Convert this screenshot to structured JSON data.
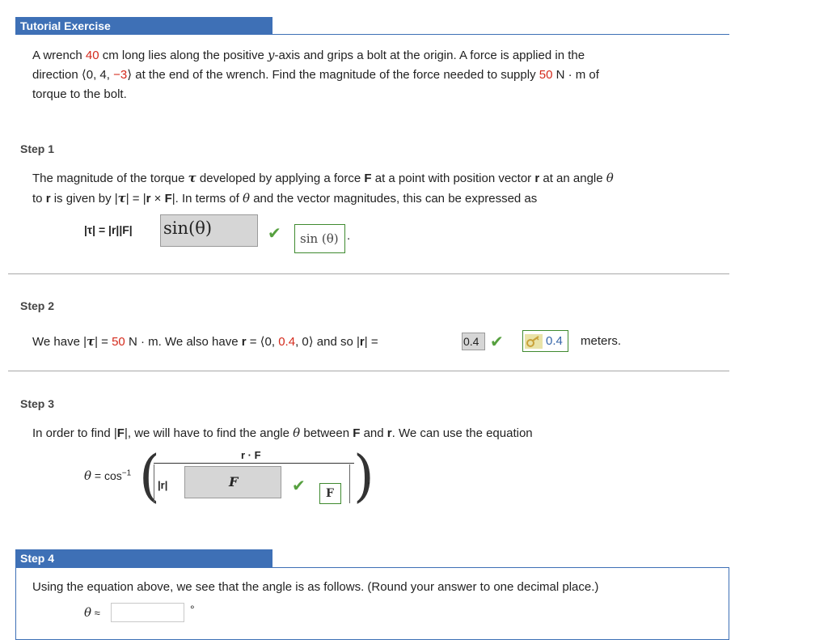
{
  "tutorial": {
    "title": "Tutorial Exercise",
    "problem": {
      "t1": "A wrench ",
      "length": "40",
      "t2": " cm long lies along the positive ",
      "yaxis": "y",
      "t3": "-axis and grips a bolt at the origin. A force is applied in the",
      "t4": "direction ",
      "open": "⟨",
      "d1": "0",
      "comma1": ", ",
      "d2": "4",
      "comma2": ", ",
      "d3": "−3",
      "close": "⟩",
      "t5": " at the end of the wrench. Find the magnitude of the force needed to supply ",
      "torque": "50",
      "t6": " N · m of",
      "t7": "torque to the bolt."
    }
  },
  "step1": {
    "label": "Step 1",
    "l1a": "The magnitude of the torque ",
    "tau": "τ",
    "l1b": " developed by applying a force ",
    "F": "F",
    "l1c": " at a point with position vector ",
    "r": "r",
    "l1d": " at an angle ",
    "theta": "θ",
    "l2a": "to ",
    "r2": "r",
    "l2b": " is given by  |",
    "tau2": "τ",
    "l2c": "|  =  |",
    "r3": "r",
    "l2d": " × ",
    "F2": "F",
    "l2e": "|.  In terms of ",
    "theta2": "θ",
    "l2f": " and the vector magnitudes, this can be expressed as",
    "eq_prefix": "|τ|  =  |r||F|",
    "answer_entered": "sin(θ)",
    "answer_key": "sin (θ)",
    "period": "."
  },
  "step2": {
    "label": "Step 2",
    "t1": "We have  |",
    "tau": "τ",
    "t2": "|  =  ",
    "torque": "50",
    "t3": " N · m.  We also have  ",
    "r": "r",
    "t4": " = ",
    "open": "⟨",
    "v1": "0",
    "c1": ", ",
    "v2": "0.4",
    "c2": ", ",
    "v3": "0",
    "close": "⟩",
    "t5": "  and so  |",
    "r2": "r",
    "t6": "|  = ",
    "answer_entered": "0.4",
    "answer_key": "0.4",
    "units": "meters."
  },
  "step3": {
    "label": "Step 3",
    "t1": "In order to find |",
    "F": "F",
    "t2": "|, we will have to find the angle ",
    "theta": "θ",
    "t3": " between ",
    "F2": "F",
    "t4": " and ",
    "r": "r",
    "t5": ". We can use the equation",
    "theta_eq": "θ",
    "eq": " = cos",
    "sup": "−1",
    "numerator": "r · F",
    "den_r": "|r|",
    "answer_entered": "F",
    "answer_key": "F",
    "period": "."
  },
  "step4": {
    "label": "Step 4",
    "text": "Using the equation above, we see that the angle is as follows. (Round your answer to one decimal place.)",
    "theta": "θ",
    "approx": " ≈",
    "input_value": "",
    "degree": "°"
  }
}
